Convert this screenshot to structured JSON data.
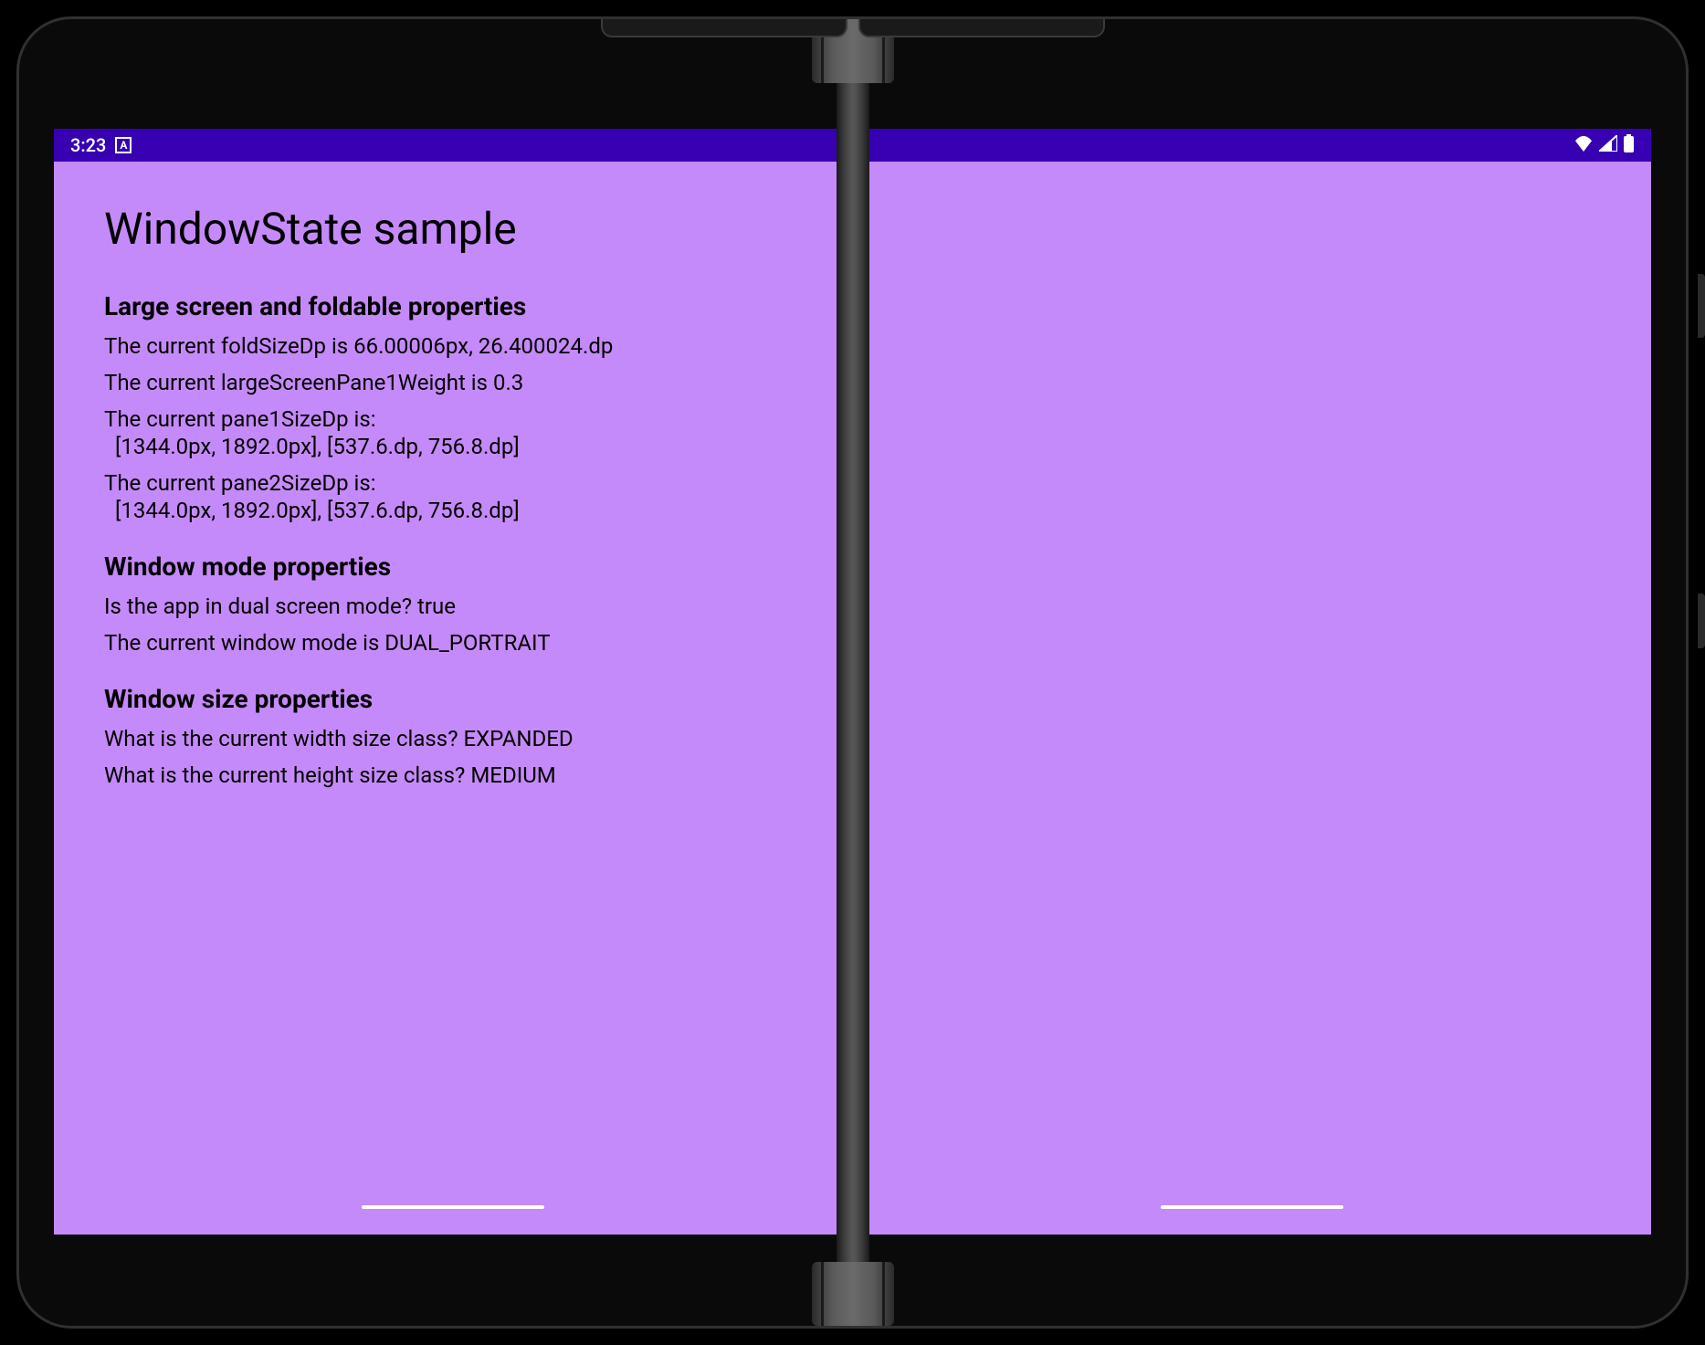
{
  "status_bar": {
    "time": "3:23",
    "badge_letter": "A"
  },
  "page": {
    "title": "WindowState sample"
  },
  "sections": {
    "foldable": {
      "heading": "Large screen and foldable properties",
      "fold_size": "The current foldSizeDp is 66.00006px, 26.400024.dp",
      "pane1_weight": "The current largeScreenPane1Weight is 0.3",
      "pane1_size_label": "The current pane1SizeDp is:",
      "pane1_size_value": "[1344.0px, 1892.0px], [537.6.dp, 756.8.dp]",
      "pane2_size_label": "The current pane2SizeDp is:",
      "pane2_size_value": "[1344.0px, 1892.0px], [537.6.dp, 756.8.dp]"
    },
    "window_mode": {
      "heading": "Window mode properties",
      "dual_screen": "Is the app in dual screen mode? true",
      "mode": "The current window mode is DUAL_PORTRAIT"
    },
    "window_size": {
      "heading": "Window size properties",
      "width_class": "What is the current width size class? EXPANDED",
      "height_class": "What is the current height size class? MEDIUM"
    }
  }
}
